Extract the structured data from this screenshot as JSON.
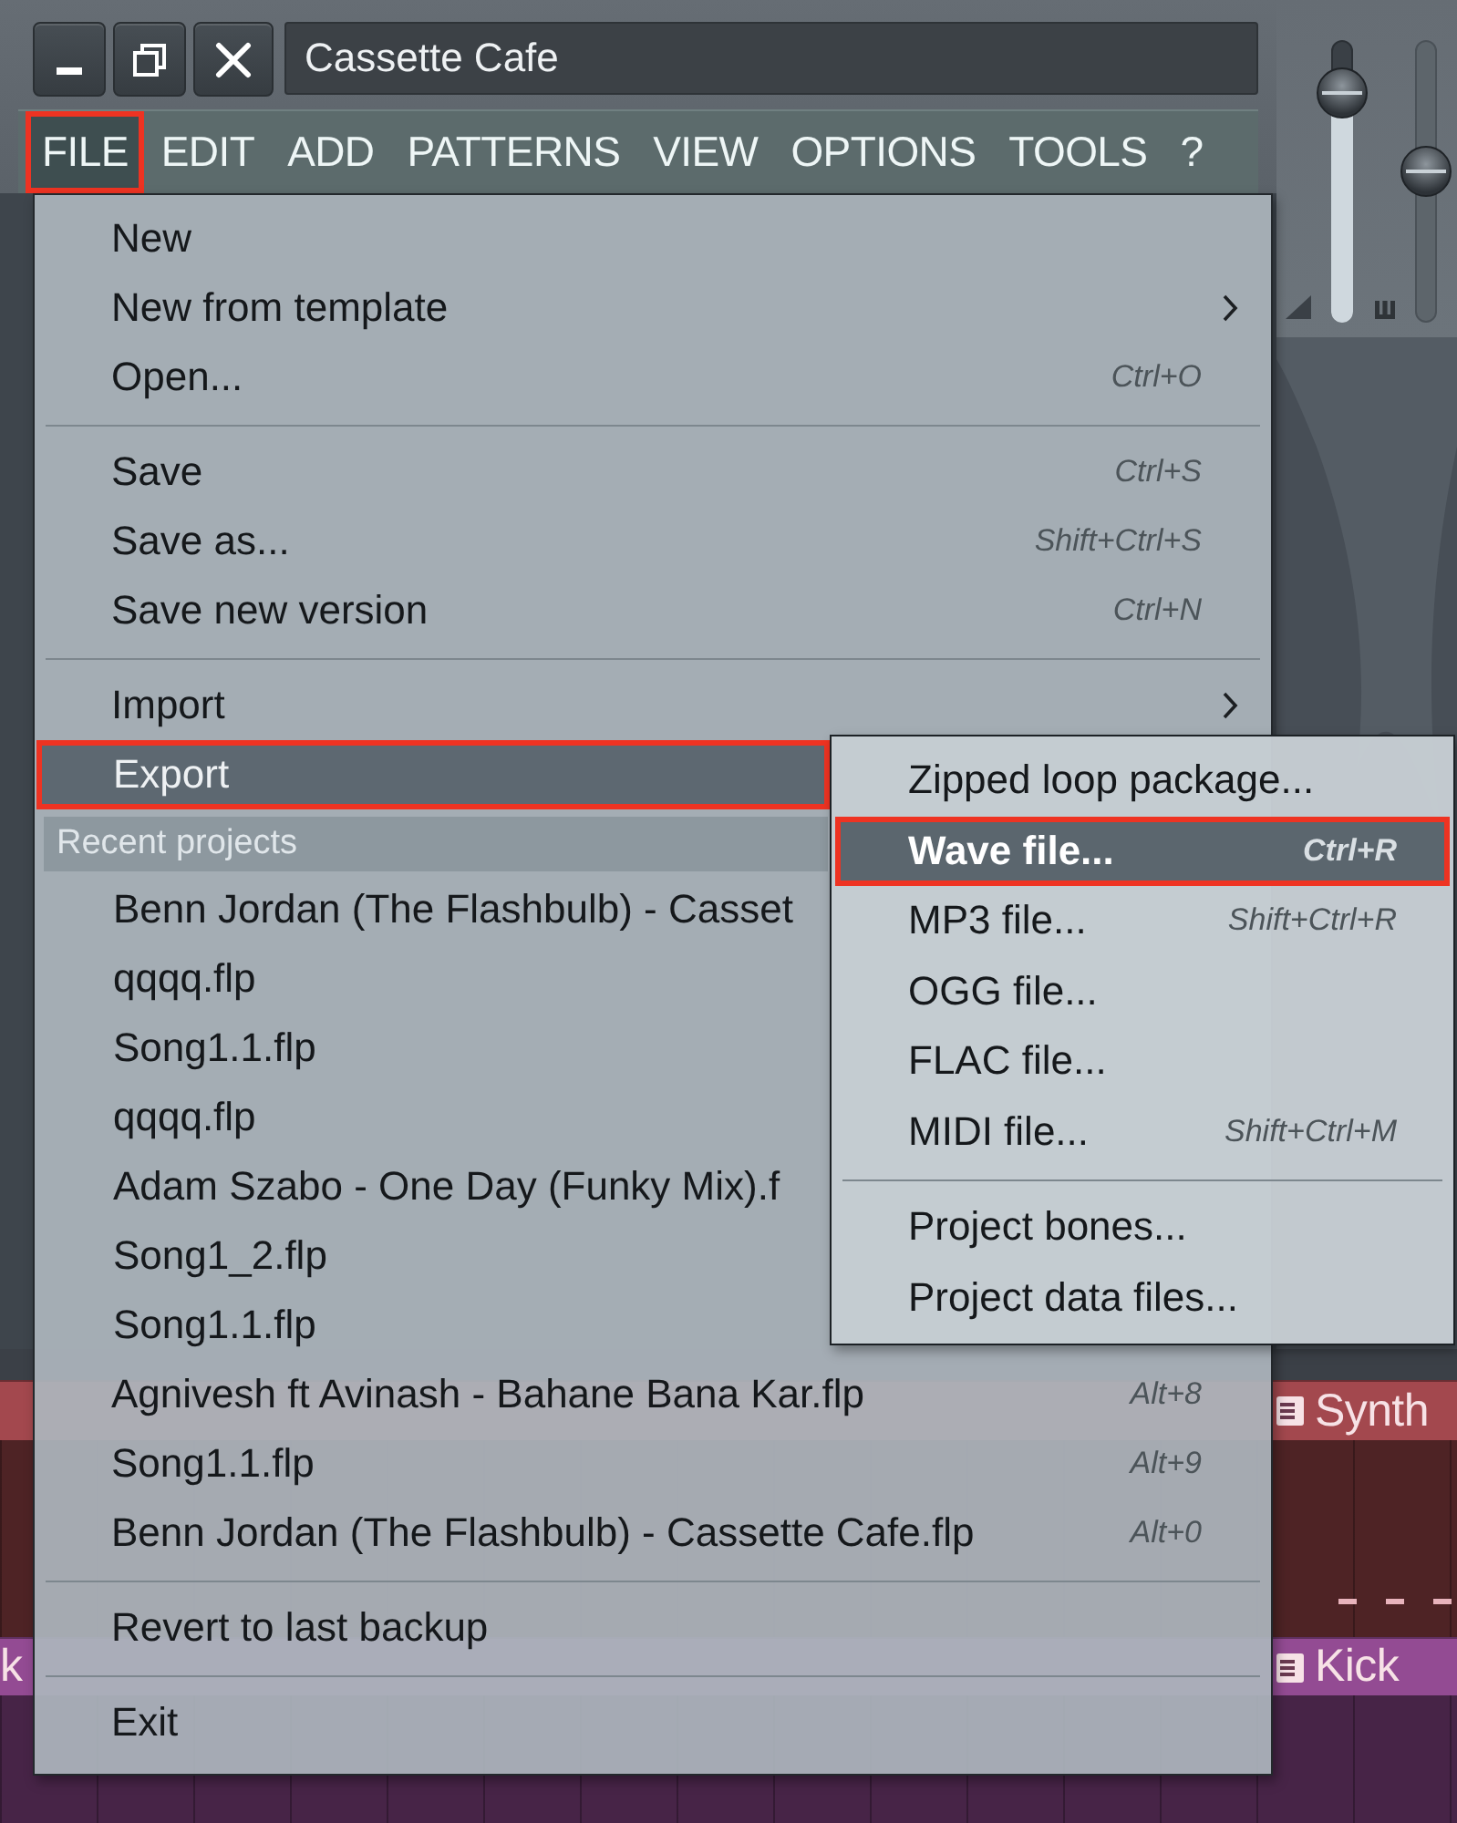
{
  "window": {
    "title": "Cassette Cafe",
    "buttons": [
      {
        "kind": "minimize"
      },
      {
        "kind": "restore"
      },
      {
        "kind": "close"
      }
    ]
  },
  "menubar": [
    {
      "label": "FILE",
      "selected": true,
      "outlined": true
    },
    {
      "label": "EDIT",
      "selected": false,
      "outlined": false
    },
    {
      "label": "ADD",
      "selected": false,
      "outlined": false
    },
    {
      "label": "PATTERNS",
      "selected": false,
      "outlined": false
    },
    {
      "label": "VIEW",
      "selected": false,
      "outlined": false
    },
    {
      "label": "OPTIONS",
      "selected": false,
      "outlined": false
    },
    {
      "label": "TOOLS",
      "selected": false,
      "outlined": false
    },
    {
      "label": "?",
      "selected": false,
      "outlined": false
    }
  ],
  "faders": [
    {
      "kind": "lit",
      "level": 0.88
    },
    {
      "kind": "unlit",
      "level": 0.54
    }
  ],
  "file_menu": {
    "items": [
      {
        "kind": "item",
        "label": "New",
        "selected": false,
        "outlined": false,
        "submenu": false
      },
      {
        "kind": "item",
        "label": "New from template",
        "selected": false,
        "outlined": false,
        "submenu": true
      },
      {
        "kind": "item",
        "label": "Open...",
        "shortcut": "Ctrl+O",
        "selected": false,
        "outlined": false,
        "submenu": false
      },
      {
        "kind": "separator"
      },
      {
        "kind": "item",
        "label": "Save",
        "shortcut": "Ctrl+S",
        "selected": false,
        "outlined": false,
        "submenu": false
      },
      {
        "kind": "item",
        "label": "Save as...",
        "shortcut": "Shift+Ctrl+S",
        "selected": false,
        "outlined": false,
        "submenu": false
      },
      {
        "kind": "item",
        "label": "Save new version",
        "shortcut": "Ctrl+N",
        "selected": false,
        "outlined": false,
        "submenu": false
      },
      {
        "kind": "separator"
      },
      {
        "kind": "item",
        "label": "Import",
        "selected": false,
        "outlined": false,
        "submenu": true
      },
      {
        "kind": "item",
        "label": "Export",
        "selected": true,
        "outlined": true,
        "submenu": false
      },
      {
        "kind": "header",
        "label": "Recent projects"
      },
      {
        "kind": "item",
        "label": "Benn Jordan (The Flashbulb) - Casset",
        "selected": false,
        "outlined": false,
        "submenu": false
      },
      {
        "kind": "item",
        "label": "qqqq.flp",
        "selected": false,
        "outlined": false,
        "submenu": false
      },
      {
        "kind": "item",
        "label": "Song1.1.flp",
        "selected": false,
        "outlined": false,
        "submenu": false
      },
      {
        "kind": "item",
        "label": "qqqq.flp",
        "selected": false,
        "outlined": false,
        "submenu": false
      },
      {
        "kind": "item",
        "label": "Adam Szabo - One Day (Funky Mix).f",
        "selected": false,
        "outlined": false,
        "submenu": false
      },
      {
        "kind": "item",
        "label": "Song1_2.flp",
        "selected": false,
        "outlined": false,
        "submenu": false
      },
      {
        "kind": "item",
        "label": "Song1.1.flp",
        "selected": false,
        "outlined": false,
        "submenu": false
      },
      {
        "kind": "item",
        "label": "Agnivesh ft Avinash - Bahane Bana Kar.flp",
        "shortcut": "Alt+8",
        "selected": false,
        "outlined": false,
        "submenu": false
      },
      {
        "kind": "item",
        "label": "Song1.1.flp",
        "shortcut": "Alt+9",
        "selected": false,
        "outlined": false,
        "submenu": false
      },
      {
        "kind": "item",
        "label": "Benn Jordan (The Flashbulb) - Cassette Cafe.flp",
        "shortcut": "Alt+0",
        "selected": false,
        "outlined": false,
        "submenu": false
      },
      {
        "kind": "separator"
      },
      {
        "kind": "item",
        "label": "Revert to last backup",
        "selected": false,
        "outlined": false,
        "submenu": false
      },
      {
        "kind": "separator"
      },
      {
        "kind": "item",
        "label": "Exit",
        "selected": false,
        "outlined": false,
        "submenu": false
      }
    ]
  },
  "export_submenu": {
    "items": [
      {
        "kind": "item",
        "label": "Zipped loop package...",
        "selected": false,
        "outlined": false
      },
      {
        "kind": "item",
        "label": "Wave file...",
        "shortcut": "Ctrl+R",
        "selected": true,
        "outlined": true
      },
      {
        "kind": "item",
        "label": "MP3 file...",
        "shortcut": "Shift+Ctrl+R",
        "selected": false,
        "outlined": false
      },
      {
        "kind": "item",
        "label": "OGG file...",
        "selected": false,
        "outlined": false
      },
      {
        "kind": "item",
        "label": "FLAC file...",
        "selected": false,
        "outlined": false
      },
      {
        "kind": "item",
        "label": "MIDI file...",
        "shortcut": "Shift+Ctrl+M",
        "selected": false,
        "outlined": false
      },
      {
        "kind": "separator"
      },
      {
        "kind": "item",
        "label": "Project bones...",
        "selected": false,
        "outlined": false
      },
      {
        "kind": "item",
        "label": "Project data files...",
        "selected": false,
        "outlined": false
      }
    ]
  },
  "playlist": {
    "tracks": [
      {
        "color": "#a3484e",
        "right_clip": {
          "label": "Synth"
        }
      },
      {
        "color": "#934b93",
        "left_clip": {
          "label": "k"
        },
        "right_clip": {
          "label": "Kick"
        }
      }
    ]
  }
}
